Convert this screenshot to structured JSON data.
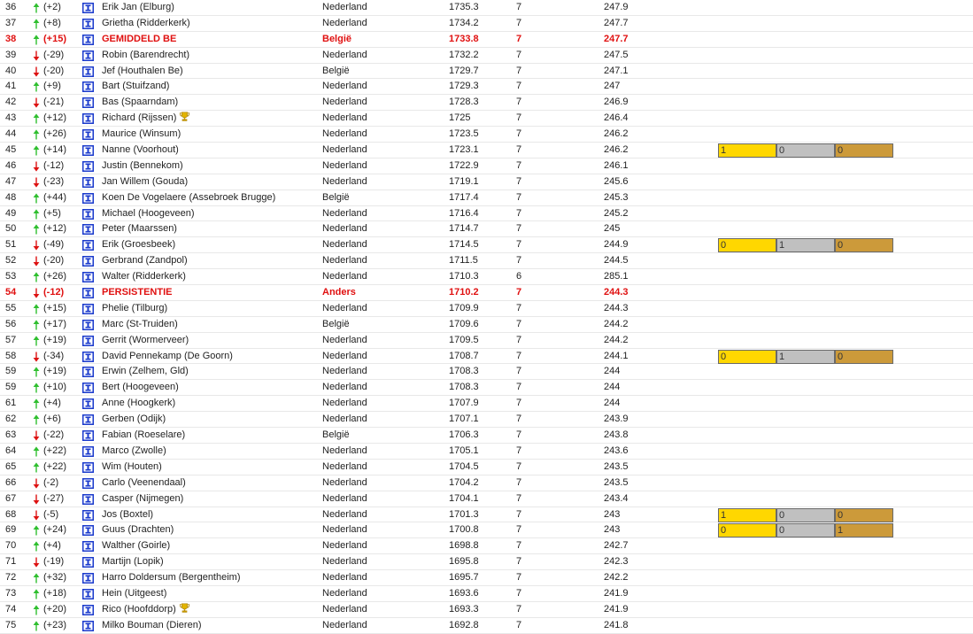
{
  "colors": {
    "trend_up": "#2fbf2f",
    "trend_down": "#dd1111",
    "highlight": "#e01010",
    "gold": "#ffd700",
    "silver": "#c0c0c0",
    "bronze": "#cc9a3a",
    "icon_blue": "#1a3acc"
  },
  "table": {
    "rows": [
      {
        "rank": "36",
        "arrow": "arrow-up-icon",
        "change": "(+2)",
        "name": "Erik Jan (Elburg)",
        "country": "Nederland",
        "score": "1735.3",
        "count": "7",
        "average": "247.9"
      },
      {
        "rank": "37",
        "arrow": "arrow-up-icon",
        "change": "(+8)",
        "name": "Grietha (Ridderkerk)",
        "country": "Nederland",
        "score": "1734.2",
        "count": "7",
        "average": "247.7"
      },
      {
        "rank": "38",
        "arrow": "arrow-up-icon",
        "change": "(+15)",
        "name": "GEMIDDELD BE",
        "country": "België",
        "score": "1733.8",
        "count": "7",
        "average": "247.7",
        "highlight": true
      },
      {
        "rank": "39",
        "arrow": "arrow-down-icon",
        "change": "(-29)",
        "name": "Robin (Barendrecht)",
        "country": "Nederland",
        "score": "1732.2",
        "count": "7",
        "average": "247.5"
      },
      {
        "rank": "40",
        "arrow": "arrow-down-icon",
        "change": "(-20)",
        "name": "Jef (Houthalen Be)",
        "country": "België",
        "score": "1729.7",
        "count": "7",
        "average": "247.1"
      },
      {
        "rank": "41",
        "arrow": "arrow-up-icon",
        "change": "(+9)",
        "name": "Bart (Stuifzand)",
        "country": "Nederland",
        "score": "1729.3",
        "count": "7",
        "average": "247"
      },
      {
        "rank": "42",
        "arrow": "arrow-down-icon",
        "change": "(-21)",
        "name": "Bas (Spaarndam)",
        "country": "Nederland",
        "score": "1728.3",
        "count": "7",
        "average": "246.9"
      },
      {
        "rank": "43",
        "arrow": "arrow-up-icon",
        "change": "(+12)",
        "name": "Richard (Rijssen)",
        "badge_icon": "trophy-icon",
        "country": "Nederland",
        "score": "1725",
        "count": "7",
        "average": "246.4"
      },
      {
        "rank": "44",
        "arrow": "arrow-up-icon",
        "change": "(+26)",
        "name": "Maurice (Winsum)",
        "country": "Nederland",
        "score": "1723.5",
        "count": "7",
        "average": "246.2"
      },
      {
        "rank": "45",
        "arrow": "arrow-up-icon",
        "change": "(+14)",
        "name": "Nanne (Voorhout)",
        "country": "Nederland",
        "score": "1723.1",
        "count": "7",
        "average": "246.2",
        "medals": {
          "gold": "1",
          "silver": "0",
          "bronze": "0"
        }
      },
      {
        "rank": "46",
        "arrow": "arrow-down-icon",
        "change": "(-12)",
        "name": "Justin (Bennekom)",
        "country": "Nederland",
        "score": "1722.9",
        "count": "7",
        "average": "246.1"
      },
      {
        "rank": "47",
        "arrow": "arrow-down-icon",
        "change": "(-23)",
        "name": "Jan Willem (Gouda)",
        "country": "Nederland",
        "score": "1719.1",
        "count": "7",
        "average": "245.6"
      },
      {
        "rank": "48",
        "arrow": "arrow-up-icon",
        "change": "(+44)",
        "name": "Koen De Vogelaere (Assebroek Brugge)",
        "country": "België",
        "score": "1717.4",
        "count": "7",
        "average": "245.3"
      },
      {
        "rank": "49",
        "arrow": "arrow-up-icon",
        "change": "(+5)",
        "name": "Michael (Hoogeveen)",
        "country": "Nederland",
        "score": "1716.4",
        "count": "7",
        "average": "245.2"
      },
      {
        "rank": "50",
        "arrow": "arrow-up-icon",
        "change": "(+12)",
        "name": "Peter (Maarssen)",
        "country": "Nederland",
        "score": "1714.7",
        "count": "7",
        "average": "245"
      },
      {
        "rank": "51",
        "arrow": "arrow-down-icon",
        "change": "(-49)",
        "name": "Erik (Groesbeek)",
        "country": "Nederland",
        "score": "1714.5",
        "count": "7",
        "average": "244.9",
        "medals": {
          "gold": "0",
          "silver": "1",
          "bronze": "0"
        }
      },
      {
        "rank": "52",
        "arrow": "arrow-down-icon",
        "change": "(-20)",
        "name": "Gerbrand (Zandpol)",
        "country": "Nederland",
        "score": "1711.5",
        "count": "7",
        "average": "244.5"
      },
      {
        "rank": "53",
        "arrow": "arrow-up-icon",
        "change": "(+26)",
        "name": "Walter (Ridderkerk)",
        "country": "Nederland",
        "score": "1710.3",
        "count": "6",
        "average": "285.1"
      },
      {
        "rank": "54",
        "arrow": "arrow-down-icon",
        "change": "(-12)",
        "name": "PERSISTENTIE",
        "country": "Anders",
        "score": "1710.2",
        "count": "7",
        "average": "244.3",
        "highlight": true
      },
      {
        "rank": "55",
        "arrow": "arrow-up-icon",
        "change": "(+15)",
        "name": "Phelie (Tilburg)",
        "country": "Nederland",
        "score": "1709.9",
        "count": "7",
        "average": "244.3"
      },
      {
        "rank": "56",
        "arrow": "arrow-up-icon",
        "change": "(+17)",
        "name": "Marc (St-Truiden)",
        "country": "België",
        "score": "1709.6",
        "count": "7",
        "average": "244.2"
      },
      {
        "rank": "57",
        "arrow": "arrow-up-icon",
        "change": "(+19)",
        "name": "Gerrit (Wormerveer)",
        "country": "Nederland",
        "score": "1709.5",
        "count": "7",
        "average": "244.2"
      },
      {
        "rank": "58",
        "arrow": "arrow-down-icon",
        "change": "(-34)",
        "name": "David Pennekamp (De Goorn)",
        "country": "Nederland",
        "score": "1708.7",
        "count": "7",
        "average": "244.1",
        "medals": {
          "gold": "0",
          "silver": "1",
          "bronze": "0"
        }
      },
      {
        "rank": "59",
        "arrow": "arrow-up-icon",
        "change": "(+19)",
        "name": "Erwin (Zelhem, Gld)",
        "country": "Nederland",
        "score": "1708.3",
        "count": "7",
        "average": "244"
      },
      {
        "rank": "59",
        "arrow": "arrow-up-icon",
        "change": "(+10)",
        "name": "Bert (Hoogeveen)",
        "country": "Nederland",
        "score": "1708.3",
        "count": "7",
        "average": "244"
      },
      {
        "rank": "61",
        "arrow": "arrow-up-icon",
        "change": "(+4)",
        "name": "Anne (Hoogkerk)",
        "country": "Nederland",
        "score": "1707.9",
        "count": "7",
        "average": "244"
      },
      {
        "rank": "62",
        "arrow": "arrow-up-icon",
        "change": "(+6)",
        "name": "Gerben (Odijk)",
        "country": "Nederland",
        "score": "1707.1",
        "count": "7",
        "average": "243.9"
      },
      {
        "rank": "63",
        "arrow": "arrow-down-icon",
        "change": "(-22)",
        "name": "Fabian (Roeselare)",
        "country": "België",
        "score": "1706.3",
        "count": "7",
        "average": "243.8"
      },
      {
        "rank": "64",
        "arrow": "arrow-up-icon",
        "change": "(+22)",
        "name": "Marco (Zwolle)",
        "country": "Nederland",
        "score": "1705.1",
        "count": "7",
        "average": "243.6"
      },
      {
        "rank": "65",
        "arrow": "arrow-up-icon",
        "change": "(+22)",
        "name": "Wim (Houten)",
        "country": "Nederland",
        "score": "1704.5",
        "count": "7",
        "average": "243.5"
      },
      {
        "rank": "66",
        "arrow": "arrow-down-icon",
        "change": "(-2)",
        "name": "Carlo (Veenendaal)",
        "country": "Nederland",
        "score": "1704.2",
        "count": "7",
        "average": "243.5"
      },
      {
        "rank": "67",
        "arrow": "arrow-down-icon",
        "change": "(-27)",
        "name": "Casper (Nijmegen)",
        "country": "Nederland",
        "score": "1704.1",
        "count": "7",
        "average": "243.4"
      },
      {
        "rank": "68",
        "arrow": "arrow-down-icon",
        "change": "(-5)",
        "name": "Jos (Boxtel)",
        "country": "Nederland",
        "score": "1701.3",
        "count": "7",
        "average": "243",
        "medals": {
          "gold": "1",
          "silver": "0",
          "bronze": "0"
        }
      },
      {
        "rank": "69",
        "arrow": "arrow-up-icon",
        "change": "(+24)",
        "name": "Guus (Drachten)",
        "country": "Nederland",
        "score": "1700.8",
        "count": "7",
        "average": "243",
        "medals": {
          "gold": "0",
          "silver": "0",
          "bronze": "1"
        }
      },
      {
        "rank": "70",
        "arrow": "arrow-up-icon",
        "change": "(+4)",
        "name": "Walther (Goirle)",
        "country": "Nederland",
        "score": "1698.8",
        "count": "7",
        "average": "242.7"
      },
      {
        "rank": "71",
        "arrow": "arrow-down-icon",
        "change": "(-19)",
        "name": "Martijn (Lopik)",
        "country": "Nederland",
        "score": "1695.8",
        "count": "7",
        "average": "242.3"
      },
      {
        "rank": "72",
        "arrow": "arrow-up-icon",
        "change": "(+32)",
        "name": "Harro Doldersum (Bergentheim)",
        "country": "Nederland",
        "score": "1695.7",
        "count": "7",
        "average": "242.2"
      },
      {
        "rank": "73",
        "arrow": "arrow-up-icon",
        "change": "(+18)",
        "name": "Hein (Uitgeest)",
        "country": "Nederland",
        "score": "1693.6",
        "count": "7",
        "average": "241.9"
      },
      {
        "rank": "74",
        "arrow": "arrow-up-icon",
        "change": "(+20)",
        "name": "Rico (Hoofddorp)",
        "badge_icon": "trophy-icon",
        "country": "Nederland",
        "score": "1693.3",
        "count": "7",
        "average": "241.9"
      },
      {
        "rank": "75",
        "arrow": "arrow-up-icon",
        "change": "(+23)",
        "name": "Milko Bouman (Dieren)",
        "country": "Nederland",
        "score": "1692.8",
        "count": "7",
        "average": "241.8"
      }
    ]
  }
}
